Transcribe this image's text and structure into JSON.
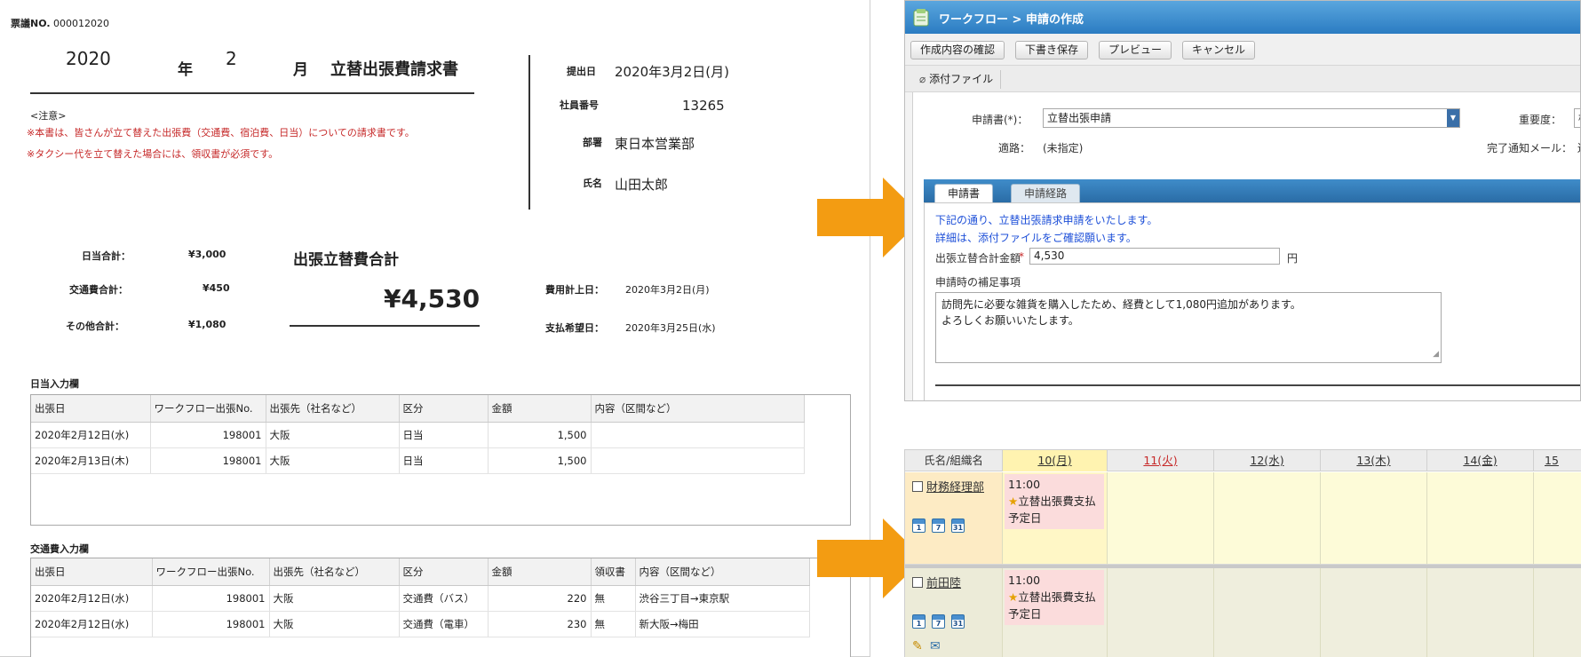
{
  "doc": {
    "slip_no_label": "票議NO.",
    "slip_no": "000012020",
    "year": "2020",
    "year_unit": "年",
    "month": "2",
    "month_unit": "月",
    "title": "立替出張費請求書",
    "note_head": "<注意>",
    "note1": "※本書は、皆さんが立て替えた出張費（交通費、宿泊費、日当）についての請求書です。",
    "note2": "※タクシー代を立て替えた場合には、領収書が必須です。",
    "submit_label": "提出日",
    "submit_value": "2020年3月2日(月)",
    "empno_label": "社員番号",
    "empno_value": "13265",
    "dept_label": "部署",
    "dept_value": "東日本営業部",
    "name_label": "氏名",
    "name_value": "山田太郎",
    "daily_total_label": "日当合計：",
    "daily_total_value": "¥3,000",
    "transport_total_label": "交通費合計：",
    "transport_total_value": "¥450",
    "other_total_label": "その他合計：",
    "other_total_value": "¥1,080",
    "grand_total_label": "出張立替費合計",
    "grand_total_value": "¥4,530",
    "expense_date_label": "費用計上日：",
    "expense_date_value": "2020年3月2日(月)",
    "payment_date_label": "支払希望日：",
    "payment_date_value": "2020年3月25日(水)",
    "daily_section": "日当入力欄",
    "daily_headers": [
      "出張日",
      "ワークフロー出張No.",
      "出張先（社名など）",
      "区分",
      "金額",
      "内容（区間など）"
    ],
    "daily_rows": [
      [
        "2020年2月12日(水)",
        "198001",
        "大阪",
        "日当",
        "1,500",
        ""
      ],
      [
        "2020年2月13日(木)",
        "198001",
        "大阪",
        "日当",
        "1,500",
        ""
      ]
    ],
    "transport_section": "交通費入力欄",
    "transport_headers": [
      "出張日",
      "ワークフロー出張No.",
      "出張先（社名など）",
      "区分",
      "金額",
      "領収書",
      "内容（区間など）"
    ],
    "transport_rows": [
      [
        "2020年2月12日(水)",
        "198001",
        "大阪",
        "交通費（バス）",
        "220",
        "無",
        "渋谷三丁目→東京駅"
      ],
      [
        "2020年2月12日(水)",
        "198001",
        "大阪",
        "交通費（電車）",
        "230",
        "無",
        "新大阪→梅田"
      ]
    ]
  },
  "workflow": {
    "title": "ワークフロー > 申請の作成",
    "buttons": [
      "作成内容の確認",
      "下書き保存",
      "プレビュー",
      "キャンセル"
    ],
    "attach_label": "添付ファイル",
    "applicant_form_label": "申請書(*)：",
    "applicant_form_value": "立替出張申請",
    "importance_label": "重要度：",
    "importance_value": "標",
    "route_label": "適路：",
    "route_value": "(未指定)",
    "notify_label": "完了通知メール：",
    "notify_value": "送",
    "tabs": [
      "申請書",
      "申請経路"
    ],
    "message1": "下記の通り、立替出張請求申請をいたします。",
    "message2": "詳細は、添付ファイルをご確認願います。",
    "amount_label": "出張立替合計金額",
    "amount_required": "*",
    "amount_value": "4,530",
    "amount_unit": "円",
    "remarks_label": "申請時の補足事項",
    "remarks_line1": "訪問先に必要な雑貨を購入したため、経費として1,080円追加があります。",
    "remarks_line2": "よろしくお願いいたします。"
  },
  "calendar": {
    "name_header": "氏名/組織名",
    "days": [
      "10(月)",
      "11(火)",
      "12(水)",
      "13(木)",
      "14(金)",
      "15"
    ],
    "rows": [
      {
        "name": "財務経理部",
        "event_time": "11:00",
        "event_title": "立替出張費支払",
        "event_sub": "予定日"
      },
      {
        "name": "前田陸",
        "event_time": "11:00",
        "event_title": "立替出張費支払",
        "event_sub": "予定日"
      }
    ],
    "icon_labels": [
      "1",
      "7",
      "31"
    ],
    "accent_today": "#fff3b0",
    "accent_holiday": "#c62828"
  },
  "colors": {
    "arrow": "#f39c12",
    "title_bar": "#2b7cc2"
  }
}
